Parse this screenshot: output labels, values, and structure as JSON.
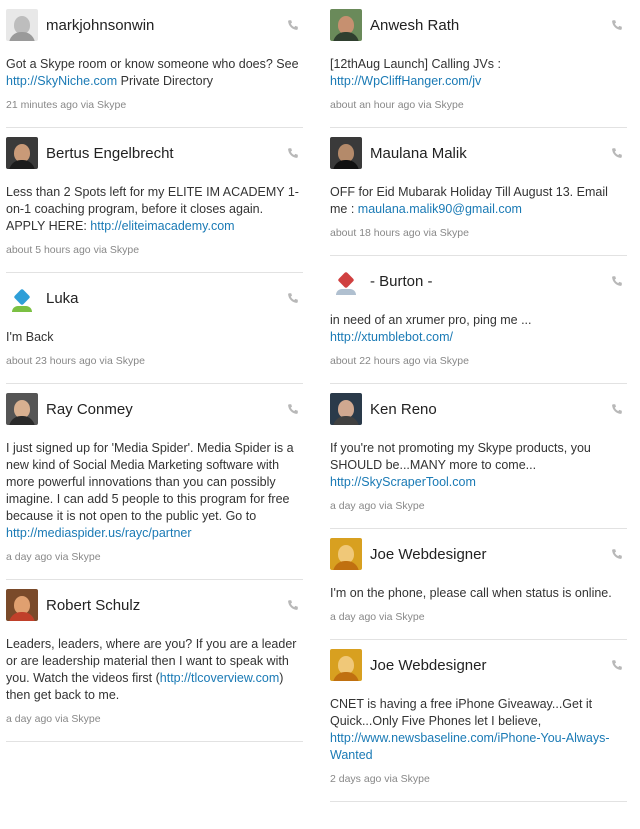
{
  "colors": {
    "link": "#1a7ab5",
    "text": "#333333",
    "meta": "#888888",
    "divider": "#e2e2e2"
  },
  "columns": {
    "left": [
      {
        "name": "markjohnsonwin",
        "avatar": "default-avatar",
        "text": "Got a Skype room or know someone who does? See ",
        "link": "http://SkyNiche.com",
        "after": " Private Directory",
        "meta": "21 minutes ago via Skype"
      },
      {
        "name": "Bertus Engelbrecht",
        "avatar": "photo-avatar",
        "text": "Less than 2 Spots left for my ELITE IM ACADEMY 1-on-1 coaching program, before it closes again. APPLY HERE: ",
        "link": "http://eliteimacademy.com",
        "after": "",
        "meta": "about 5 hours ago via Skype"
      },
      {
        "name": "Luka",
        "avatar": "logo-avatar",
        "text": "I'm Back",
        "link": "",
        "after": "",
        "meta": "about 23 hours ago via Skype"
      },
      {
        "name": "Ray Conmey",
        "avatar": "photo-avatar",
        "text": "I just signed up for 'Media Spider'. Media Spider is a new kind of Social Media Marketing software with more powerful innovations than you can possibly imagine. I can add 5 people to this program for free because it is not open to the public yet. Go to ",
        "link": "http://mediaspider.us/rayc/partner",
        "after": "",
        "meta": "a day ago via Skype"
      },
      {
        "name": "Robert Schulz",
        "avatar": "photo-avatar",
        "text": "Leaders, leaders, where are you? If you are a leader or are leadership material then I want to speak with you. Watch the videos first (",
        "link": "http://tlcoverview.com",
        "after": ") then get back to me.",
        "meta": "a day ago via Skype"
      }
    ],
    "right": [
      {
        "name": "Anwesh Rath",
        "avatar": "photo-avatar",
        "text": "[12thAug Launch] Calling JVs : ",
        "link": "http://WpCliffHanger.com/jv",
        "after": "",
        "meta": "about an hour ago via Skype"
      },
      {
        "name": "Maulana Malik",
        "avatar": "photo-avatar",
        "text": "OFF for Eid Mubarak Holiday Till August 13. Email me : ",
        "link": "maulana.malik90@gmail.com",
        "after": "",
        "meta": "about 18 hours ago via Skype"
      },
      {
        "name": "- Burton -",
        "avatar": "logo-avatar",
        "text": "in need of an xrumer pro, ping me ... ",
        "link": "http://xtumblebot.com/",
        "after": "",
        "meta": "about 22 hours ago via Skype"
      },
      {
        "name": "Ken Reno",
        "avatar": "photo-avatar",
        "text": "If you're not promoting my Skype products, you SHOULD be...MANY more to come... ",
        "link": "http://SkyScraperTool.com",
        "after": "",
        "meta": "a day ago via Skype"
      },
      {
        "name": "Joe Webdesigner",
        "avatar": "photo-avatar",
        "text": "I'm on the phone, please call when status is online.",
        "link": "",
        "after": "",
        "meta": "a day ago via Skype"
      },
      {
        "name": "Joe Webdesigner",
        "avatar": "photo-avatar",
        "text": "CNET is having a free iPhone Giveaway...Get it Quick...Only Five Phones let I believe, ",
        "link": "http://www.newsbaseline.com/iPhone-You-Always-Wanted",
        "after": "",
        "meta": "2 days ago via Skype"
      }
    ]
  }
}
